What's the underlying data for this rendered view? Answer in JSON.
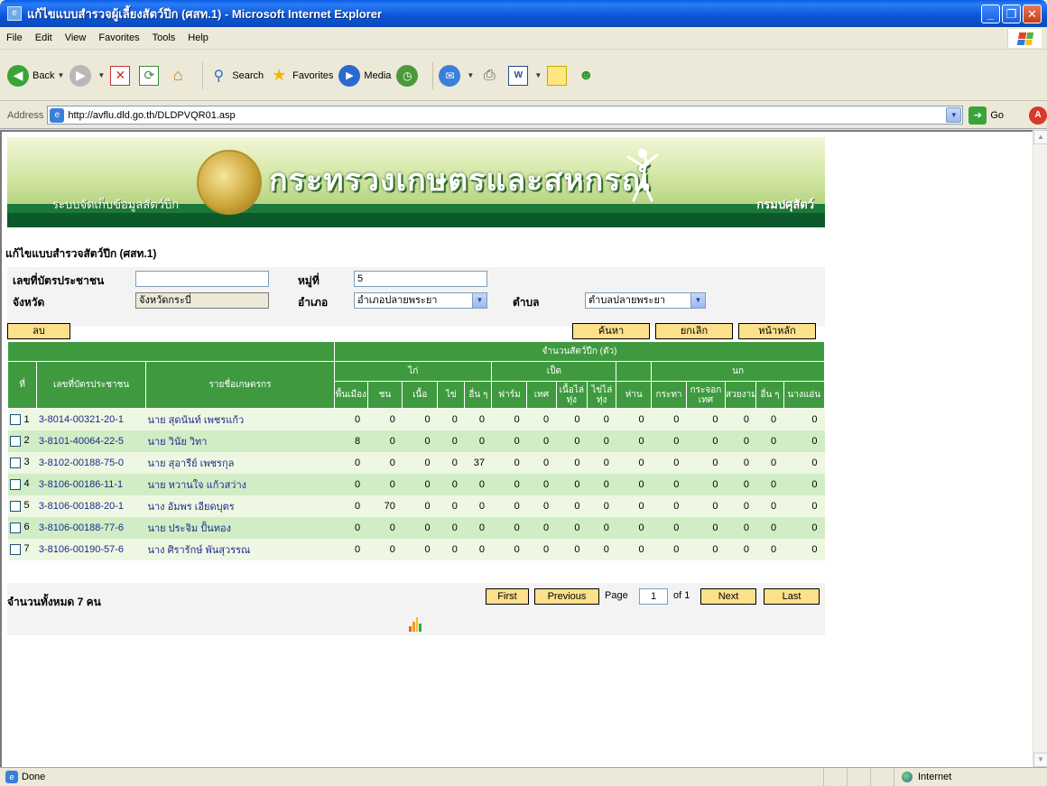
{
  "window": {
    "title": "แก้ไขแบบสำรวจผู้เลี้ยงสัตว์ปีก (ศสท.1) - Microsoft Internet Explorer"
  },
  "menu": [
    "File",
    "Edit",
    "View",
    "Favorites",
    "Tools",
    "Help"
  ],
  "toolbar": {
    "back": "Back",
    "search": "Search",
    "favorites": "Favorites",
    "media": "Media"
  },
  "address": {
    "label": "Address",
    "url": "http://avflu.dld.go.th/DLDPVQR01.asp",
    "go": "Go"
  },
  "banner": {
    "ministry": "กระทรวงเกษตรและสหกรณ์",
    "system": "ระบบจัดเก็บข้อมูลสัตว์ปีก",
    "department": "กรมปศุสัตว์"
  },
  "page_heading": "แก้ไขแบบสำรวจสัตว์ปีก (ศสท.1)",
  "form": {
    "id_label": "เลขที่บัตรประชาชน",
    "id_value": "",
    "village_label": "หมู่ที่",
    "village_value": "5",
    "province_label": "จังหวัด",
    "province_value": "จังหวัดกระบี่",
    "district_label": "อำเภอ",
    "district_value": "อำเภอปลายพระยา",
    "subdistrict_label": "ตำบล",
    "subdistrict_value": "ตำบลปลายพระยา"
  },
  "actions": {
    "delete": "ลบ",
    "search": "ค้นหา",
    "cancel": "ยกเลิก",
    "home": "หน้าหลัก"
  },
  "table": {
    "col_no": "ที่",
    "col_id": "เลขที่บัตรประชาชน",
    "col_name": "รายชื่อเกษตรกร",
    "group_total": "จำนวนสัตว์ปีก (ตัว)",
    "group_chicken": "ไก่",
    "group_duck": "เป็ด",
    "group_bird": "นก",
    "sub": [
      "พื้นเมือง",
      "ชน",
      "เนื้อ",
      "ไข่",
      "อื่น ๆ",
      "ฟาร์ม",
      "เทศ",
      "เนื้อไล่ทุ่ง",
      "ไข่ไล่ทุ่ง",
      "ห่าน",
      "กระทา",
      "กระจอกเทศ",
      "สวยงาม",
      "อื่น ๆ",
      "นางแอ่น"
    ],
    "rows": [
      {
        "no": "1",
        "id": "3-8014-00321-20-1",
        "name": "นาย สุดนันท์ เพชรแก้ว",
        "counts": [
          0,
          0,
          0,
          0,
          0,
          0,
          0,
          0,
          0,
          0,
          0,
          0,
          0,
          0,
          0
        ]
      },
      {
        "no": "2",
        "id": "3-8101-40064-22-5",
        "name": "นาย วินัย วิทา",
        "counts": [
          8,
          0,
          0,
          0,
          0,
          0,
          0,
          0,
          0,
          0,
          0,
          0,
          0,
          0,
          0
        ]
      },
      {
        "no": "3",
        "id": "3-8102-00188-75-0",
        "name": "นาย สุอารีย์ เพชรกุล",
        "counts": [
          0,
          0,
          0,
          0,
          37,
          0,
          0,
          0,
          0,
          0,
          0,
          0,
          0,
          0,
          0
        ]
      },
      {
        "no": "4",
        "id": "3-8106-00186-11-1",
        "name": "นาย หวานใจ แก้วสว่าง",
        "counts": [
          0,
          0,
          0,
          0,
          0,
          0,
          0,
          0,
          0,
          0,
          0,
          0,
          0,
          0,
          0
        ]
      },
      {
        "no": "5",
        "id": "3-8106-00188-20-1",
        "name": "นาง อัมพร เอียดบุตร",
        "counts": [
          0,
          70,
          0,
          0,
          0,
          0,
          0,
          0,
          0,
          0,
          0,
          0,
          0,
          0,
          0
        ]
      },
      {
        "no": "6",
        "id": "3-8106-00188-77-6",
        "name": "นาย ประจิม ปั้นทอง",
        "counts": [
          0,
          0,
          0,
          0,
          0,
          0,
          0,
          0,
          0,
          0,
          0,
          0,
          0,
          0,
          0
        ]
      },
      {
        "no": "7",
        "id": "3-8106-00190-57-6",
        "name": "นาง ศิรารักษ์ พันสุวรรณ",
        "counts": [
          0,
          0,
          0,
          0,
          0,
          0,
          0,
          0,
          0,
          0,
          0,
          0,
          0,
          0,
          0
        ]
      }
    ]
  },
  "footer": {
    "total": "จำนวนทั้งหมด 7 คน",
    "first": "First",
    "previous": "Previous",
    "page_label": "Page",
    "page_value": "1",
    "of": "of 1",
    "next": "Next",
    "last": "Last"
  },
  "status": {
    "text": "Done",
    "zone": "Internet"
  }
}
